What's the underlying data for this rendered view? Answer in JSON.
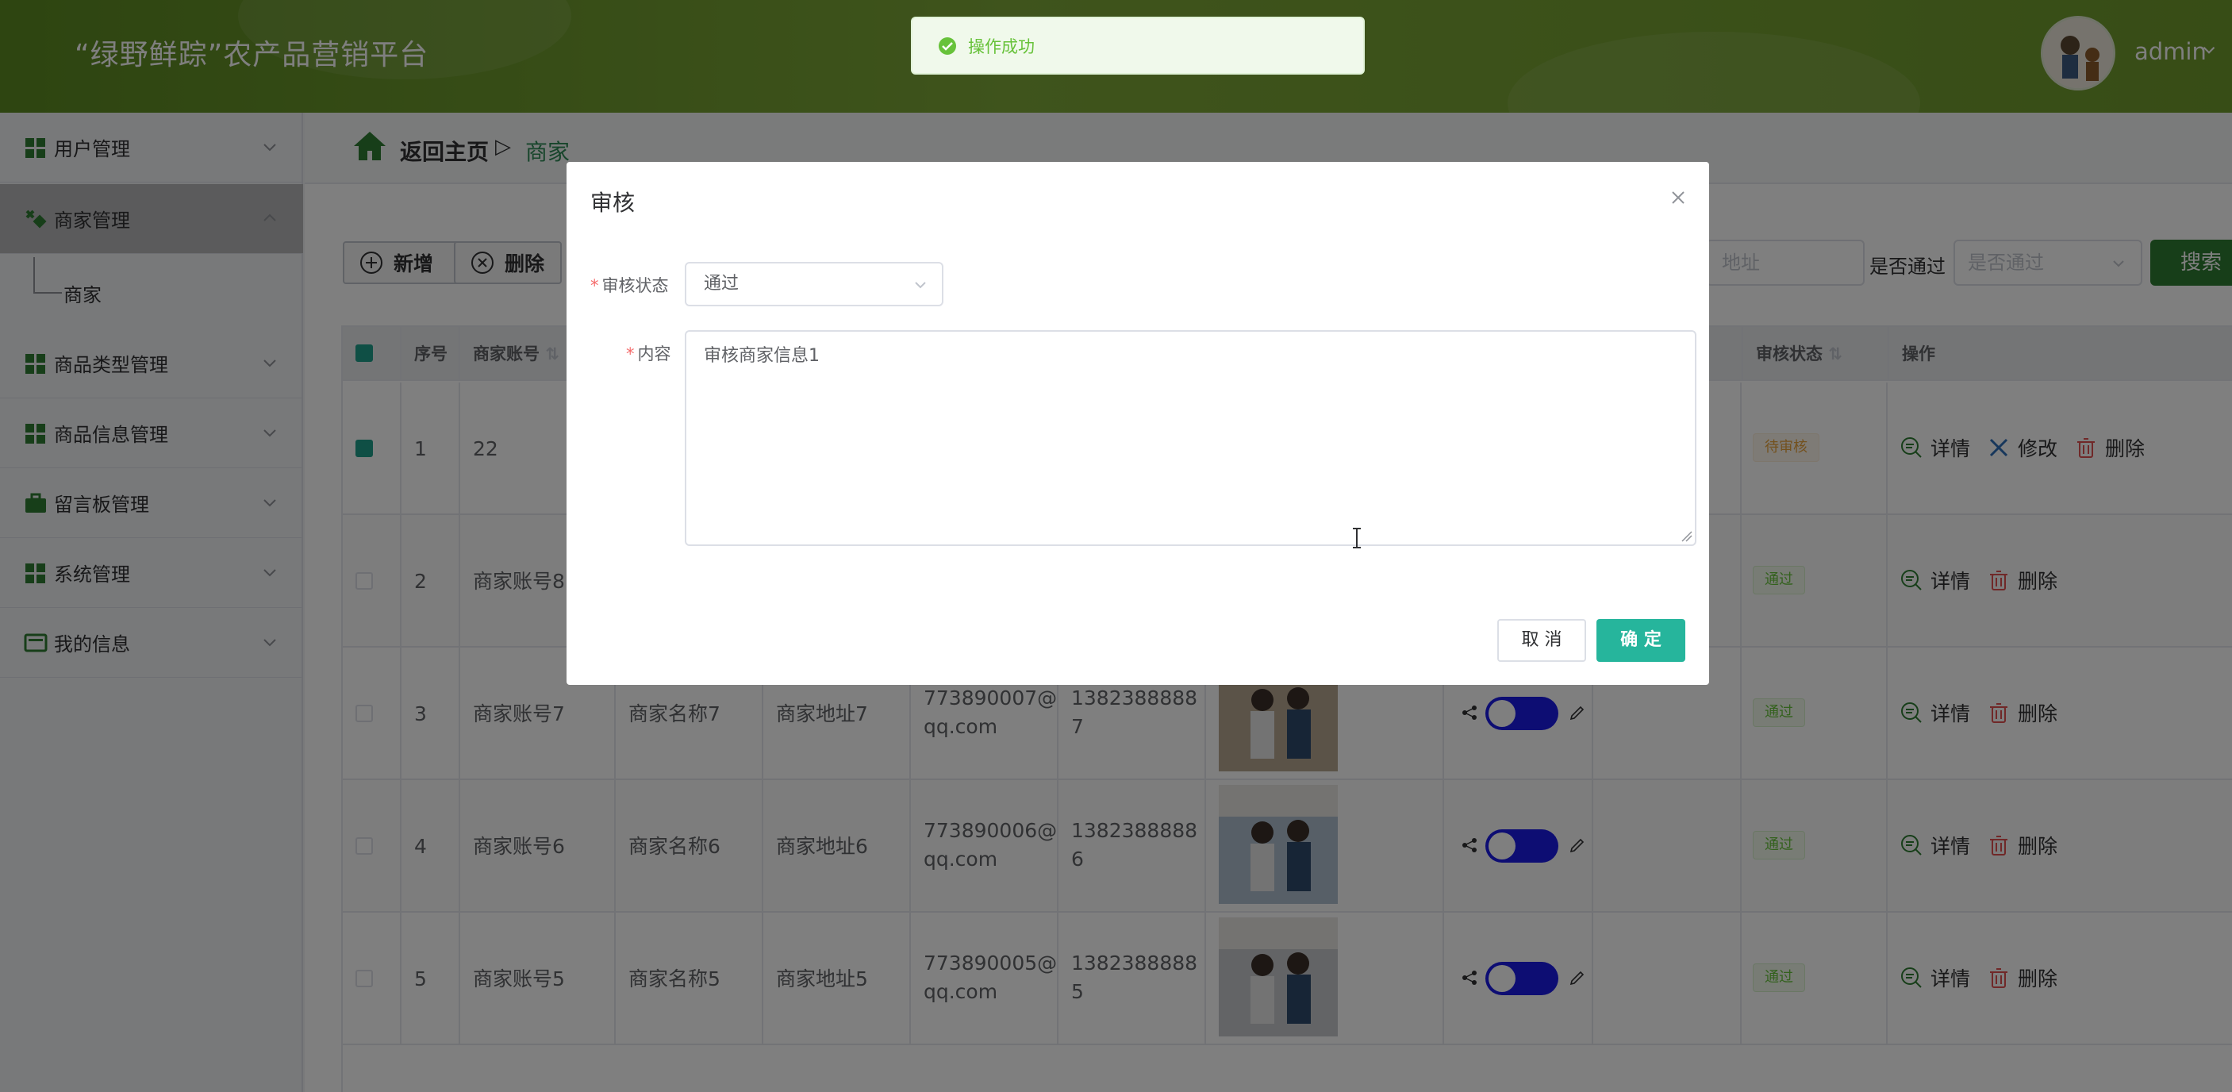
{
  "app": {
    "title": "“绿野鲜踪”农产品营销平台",
    "user": "admin"
  },
  "toast": {
    "message": "操作成功"
  },
  "sidebar": {
    "items": [
      {
        "label": "用户管理"
      },
      {
        "label": "商家管理",
        "active": true
      },
      {
        "label": "商品类型管理"
      },
      {
        "label": "商品信息管理"
      },
      {
        "label": "留言板管理"
      },
      {
        "label": "系统管理"
      },
      {
        "label": "我的信息"
      }
    ],
    "subitem": {
      "label": "商家"
    }
  },
  "breadcrumb": {
    "home": "返回主页",
    "separator": "▷",
    "current": "商家"
  },
  "toolbar": {
    "add": "新增",
    "delete": "删除"
  },
  "search": {
    "address_placeholder": "地址",
    "pass_label": "是否通过",
    "pass_placeholder": "是否通过",
    "button": "搜索"
  },
  "table": {
    "headers": {
      "index": "序号",
      "account": "商家账号",
      "status": "审核状态",
      "actions": "操作"
    },
    "rows": [
      {
        "index": "1",
        "account": "22",
        "name": "",
        "address": "",
        "email1": "",
        "email2": "",
        "phone1": "",
        "phone2": "",
        "status": "待审核",
        "actions": [
          "详情",
          "修改",
          "删除"
        ],
        "checked": true
      },
      {
        "index": "2",
        "account": "商家账号8",
        "name": "",
        "address": "",
        "email1": "",
        "email2": "",
        "phone1": "",
        "phone2": "",
        "status": "通过",
        "actions": [
          "详情",
          "删除"
        ]
      },
      {
        "index": "3",
        "account": "商家账号7",
        "name": "商家名称7",
        "address": "商家地址7",
        "email1": "773890007@",
        "email2": "qq.com",
        "phone1": "1382388888",
        "phone2": "7",
        "status": "通过",
        "actions": [
          "详情",
          "删除"
        ]
      },
      {
        "index": "4",
        "account": "商家账号6",
        "name": "商家名称6",
        "address": "商家地址6",
        "email1": "773890006@",
        "email2": "qq.com",
        "phone1": "1382388888",
        "phone2": "6",
        "status": "通过",
        "actions": [
          "详情",
          "删除"
        ]
      },
      {
        "index": "5",
        "account": "商家账号5",
        "name": "商家名称5",
        "address": "商家地址5",
        "email1": "773890005@",
        "email2": "qq.com",
        "phone1": "1382388888",
        "phone2": "5",
        "status": "通过",
        "actions": [
          "详情",
          "删除"
        ]
      }
    ]
  },
  "dialog": {
    "title": "审核",
    "status_label": "审核状态",
    "status_value": "通过",
    "content_label": "内容",
    "content_value": "审核商家信息1",
    "cancel": "取 消",
    "confirm": "确 定"
  },
  "colors": {
    "header_green": "#6f9a2d",
    "accent_teal": "#26b59c",
    "toggle_blue": "#1a1ae6",
    "status_pass": "#67c23a",
    "status_pending": "#e6a23c"
  }
}
